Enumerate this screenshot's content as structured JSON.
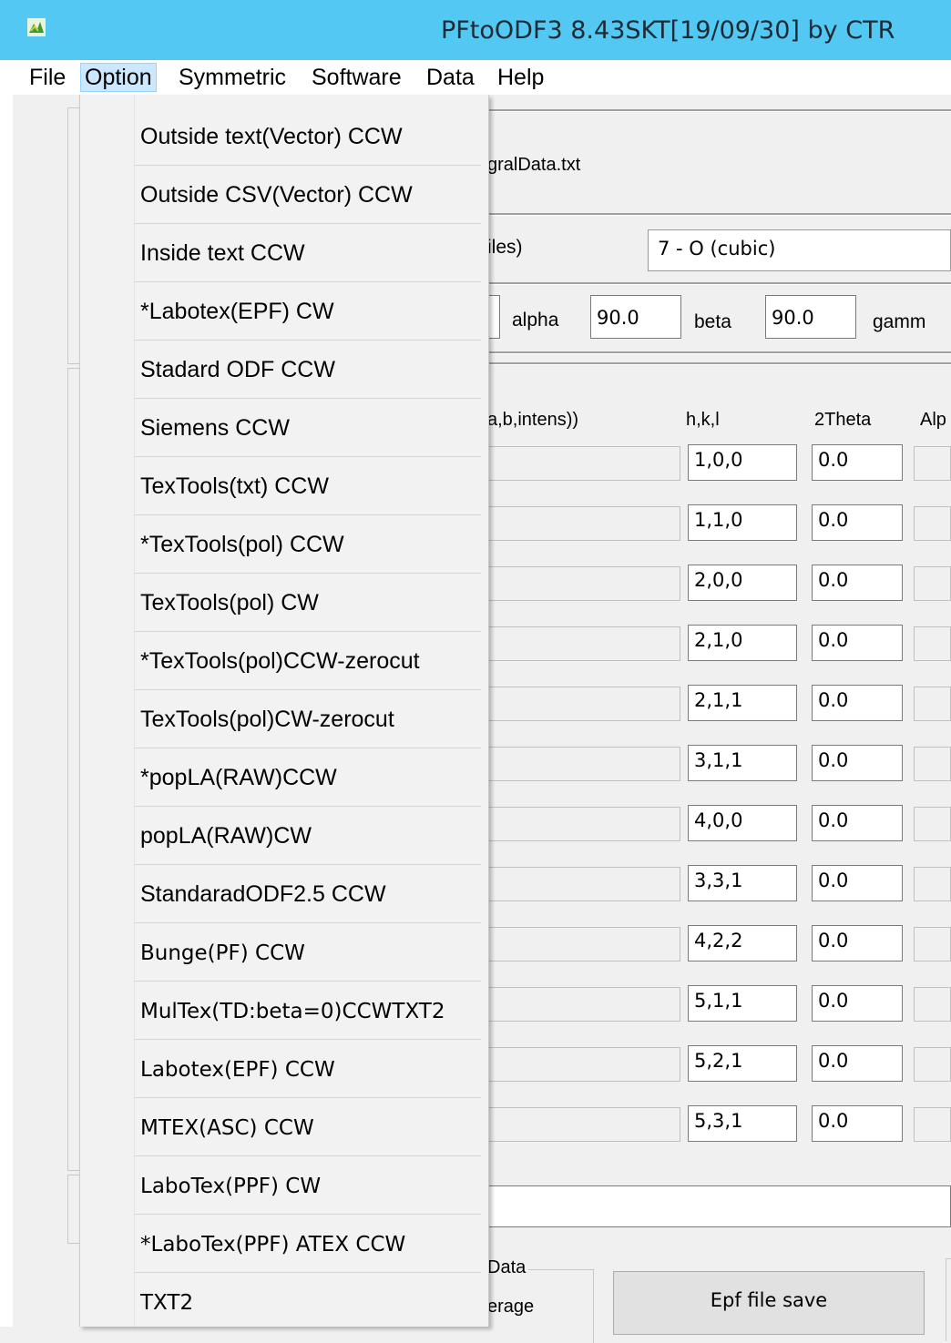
{
  "window": {
    "title": "PFtoODF3 8.43SKT[19/09/30] by CTR"
  },
  "menubar": {
    "file": "File",
    "option": "Option",
    "symmetric": "Symmetric",
    "software": "Software",
    "data": "Data",
    "help": "Help"
  },
  "option_menu": [
    "Outside text(Vector) CCW",
    "Outside CSV(Vector) CCW",
    "Inside text CCW",
    "*Labotex(EPF) CW",
    "Stadard ODF CCW",
    "Siemens CCW",
    "TexTools(txt) CCW",
    "*TexTools(pol) CCW",
    "TexTools(pol) CW",
    "*TexTools(pol)CCW-zerocut",
    "TexTools(pol)CW-zerocut",
    "*popLA(RAW)CCW",
    "popLA(RAW)CW",
    "StandaradODF2.5 CCW",
    "Bunge(PF) CCW",
    "MulTex(TD:beta=0)CCWTXT2",
    "Labotex(EPF) CCW",
    "MTEX(ASC) CCW",
    "LaboTex(PPF) CW",
    "*LaboTex(PPF) ATEX CCW",
    "TXT2"
  ],
  "main": {
    "file_text": "gralData.txt",
    "files_label": "iles)",
    "symmetry_combo": "7 - O (cubic)",
    "alpha_label": "alpha",
    "alpha_value": "90.0",
    "beta_label": "beta",
    "beta_value": "90.0",
    "gamma_label": "gamm",
    "list_header_left": "a,b,intens))",
    "col_hkl": "h,k,l",
    "col_2theta": "2Theta",
    "col_alpha": "Alp",
    "rows": [
      {
        "hkl": "1,0,0",
        "two_theta": "0.0"
      },
      {
        "hkl": "1,1,0",
        "two_theta": "0.0"
      },
      {
        "hkl": "2,0,0",
        "two_theta": "0.0"
      },
      {
        "hkl": "2,1,0",
        "two_theta": "0.0"
      },
      {
        "hkl": "2,1,1",
        "two_theta": "0.0"
      },
      {
        "hkl": "3,1,1",
        "two_theta": "0.0"
      },
      {
        "hkl": "4,0,0",
        "two_theta": "0.0"
      },
      {
        "hkl": "3,3,1",
        "two_theta": "0.0"
      },
      {
        "hkl": "4,2,2",
        "two_theta": "0.0"
      },
      {
        "hkl": "5,1,1",
        "two_theta": "0.0"
      },
      {
        "hkl": "5,2,1",
        "two_theta": "0.0"
      },
      {
        "hkl": "5,3,1",
        "two_theta": "0.0"
      }
    ],
    "data_group_label": "Data",
    "average_label": "erage",
    "epf_save_button": "Epf file save"
  },
  "colors": {
    "titlebar": "#52c8f2",
    "menu_highlight": "#cce8ff"
  }
}
